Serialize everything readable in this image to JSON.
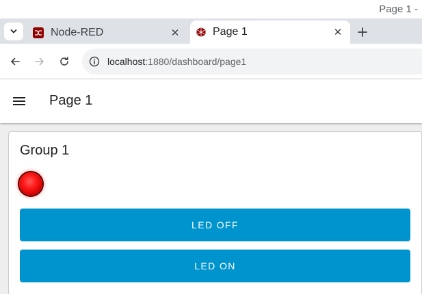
{
  "window": {
    "title": "Page 1 -"
  },
  "tabs": [
    {
      "title": "Node-RED",
      "favicon": "node-red-icon",
      "close": "✕",
      "active": false
    },
    {
      "title": "Page 1",
      "favicon": "dashboard-icon",
      "close": "✕",
      "active": true
    }
  ],
  "toolbar": {
    "url_host": "localhost",
    "url_path": ":1880/dashboard/page1"
  },
  "header": {
    "title": "Page 1"
  },
  "group": {
    "title": "Group 1",
    "led": {
      "state": "on",
      "color": "#ff1a1a"
    },
    "buttons": {
      "off_label": "LED OFF",
      "on_label": "LED ON"
    }
  },
  "colors": {
    "button": "#0094ce",
    "tab_strip": "#dee1e6"
  }
}
